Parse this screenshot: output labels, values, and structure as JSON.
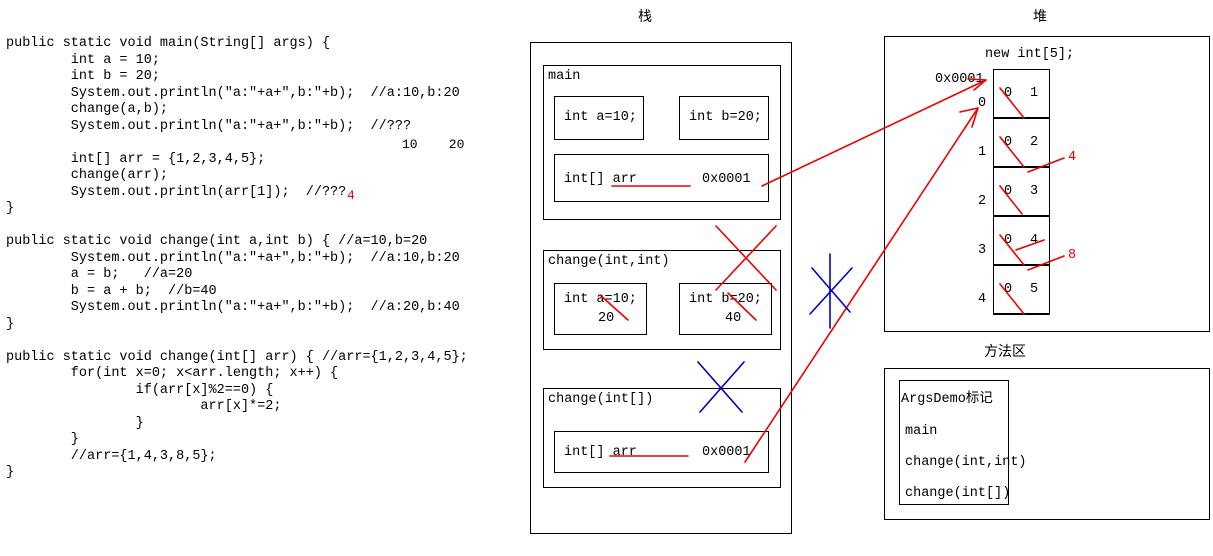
{
  "code": {
    "lines": [
      "public static void main(String[] args) {",
      "        int a = 10;",
      "        int b = 20;",
      "        System.out.println(\"a:\"+a+\",b:\"+b);  //a:10,b:20",
      "        change(a,b);",
      "        System.out.println(\"a:\"+a+\",b:\"+b);  //???",
      "",
      "        int[] arr = {1,2,3,4,5};",
      "        change(arr);",
      "        System.out.println(arr[1]);  //???",
      "}",
      "",
      "public static void change(int a,int b) { //a=10,b=20",
      "        System.out.println(\"a:\"+a+\",b:\"+b);  //a:10,b:20",
      "        a = b;   //a=20",
      "        b = a + b;  //b=40",
      "        System.out.println(\"a:\"+a+\",b:\"+b);  //a:20,b:40",
      "}",
      "",
      "public static void change(int[] arr) { //arr={1,2,3,4,5};",
      "        for(int x=0; x<arr.length; x++) {",
      "                if(arr[x]%2==0) {",
      "                        arr[x]*=2;",
      "                }",
      "        }",
      "        //arr={1,4,3,8,5};",
      "}"
    ],
    "annotations": {
      "main_ab_result": "10    20",
      "arr_result": "4"
    }
  },
  "stack": {
    "title": "栈",
    "frames": [
      {
        "name": "main",
        "slots": [
          {
            "label": "int a=10;"
          },
          {
            "label": "int b=20;"
          }
        ],
        "ref_slot": {
          "label": "int[] arr",
          "address": "0x0001"
        }
      },
      {
        "name": "change(int,int)",
        "slots": [
          {
            "label": "int a=10;",
            "new_value": "20"
          },
          {
            "label": "int b=20;",
            "new_value": "40"
          }
        ]
      },
      {
        "name": "change(int[])",
        "ref_slot": {
          "label": "int[] arr",
          "address": "0x0001"
        }
      }
    ]
  },
  "heap": {
    "title": "堆",
    "allocation": "new int[5];",
    "address": "0x0001",
    "cells": [
      {
        "index": "0",
        "initial": "0",
        "value": "1",
        "updated": ""
      },
      {
        "index": "1",
        "initial": "0",
        "value": "2",
        "updated": "4"
      },
      {
        "index": "2",
        "initial": "0",
        "value": "3",
        "updated": ""
      },
      {
        "index": "3",
        "initial": "0",
        "value": "4",
        "updated": "8"
      },
      {
        "index": "4",
        "initial": "0",
        "value": "5",
        "updated": ""
      }
    ]
  },
  "method_area": {
    "title": "方法区",
    "class_name": "ArgsDemo标记",
    "methods": [
      "main",
      "change(int,int)",
      "change(int[])"
    ]
  },
  "colors": {
    "ink": "#000000",
    "annotation_red": "#ee0000",
    "annotation_blue": "#0000cc"
  }
}
